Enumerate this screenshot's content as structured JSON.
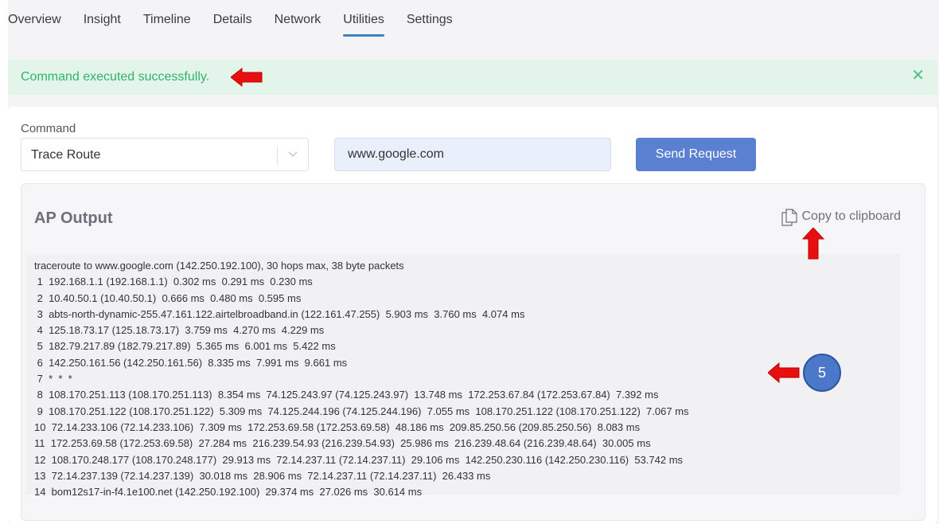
{
  "tabs": [
    {
      "label": "Overview"
    },
    {
      "label": "Insight"
    },
    {
      "label": "Timeline"
    },
    {
      "label": "Details"
    },
    {
      "label": "Network"
    },
    {
      "label": "Utilities",
      "active": true
    },
    {
      "label": "Settings"
    }
  ],
  "alert": {
    "message": "Command executed successfully.",
    "close_icon": "close-icon",
    "color": "#2fb36a",
    "background": "#e3f5ea"
  },
  "command": {
    "label": "Command",
    "selected": "Trace Route",
    "dropdown_icon": "chevron-down-icon"
  },
  "host_input": {
    "value": "www.google.com"
  },
  "send_button": {
    "label": "Send Request",
    "color": "#5b7fd1"
  },
  "output": {
    "title": "AP Output",
    "copy_label": "Copy to clipboard",
    "copy_icon": "copy-icon",
    "lines": [
      "traceroute to www.google.com (142.250.192.100), 30 hops max, 38 byte packets",
      " 1  192.168.1.1 (192.168.1.1)  0.302 ms  0.291 ms  0.230 ms",
      " 2  10.40.50.1 (10.40.50.1)  0.666 ms  0.480 ms  0.595 ms",
      " 3  abts-north-dynamic-255.47.161.122.airtelbroadband.in (122.161.47.255)  5.903 ms  3.760 ms  4.074 ms",
      " 4  125.18.73.17 (125.18.73.17)  3.759 ms  4.270 ms  4.229 ms",
      " 5  182.79.217.89 (182.79.217.89)  5.365 ms  6.001 ms  5.422 ms",
      " 6  142.250.161.56 (142.250.161.56)  8.335 ms  7.991 ms  9.661 ms",
      " 7  *  *  *",
      " 8  108.170.251.113 (108.170.251.113)  8.354 ms  74.125.243.97 (74.125.243.97)  13.748 ms  172.253.67.84 (172.253.67.84)  7.392 ms",
      " 9  108.170.251.122 (108.170.251.122)  5.309 ms  74.125.244.196 (74.125.244.196)  7.055 ms  108.170.251.122 (108.170.251.122)  7.067 ms",
      "10  72.14.233.106 (72.14.233.106)  7.309 ms  172.253.69.58 (172.253.69.58)  48.186 ms  209.85.250.56 (209.85.250.56)  8.083 ms",
      "11  172.253.69.58 (172.253.69.58)  27.284 ms  216.239.54.93 (216.239.54.93)  25.986 ms  216.239.48.64 (216.239.48.64)  30.005 ms",
      "12  108.170.248.177 (108.170.248.177)  29.913 ms  72.14.237.11 (72.14.237.11)  29.106 ms  142.250.230.116 (142.250.230.116)  53.742 ms",
      "13  72.14.237.139 (72.14.237.139)  30.018 ms  28.906 ms  72.14.237.11 (72.14.237.11)  26.433 ms",
      "14  bom12s17-in-f4.1e100.net (142.250.192.100)  29.374 ms  27.026 ms  30.614 ms"
    ]
  },
  "annotations": {
    "badge_number": "5",
    "arrow_color": "#e8100f",
    "badge_color": "#4b78c8"
  }
}
